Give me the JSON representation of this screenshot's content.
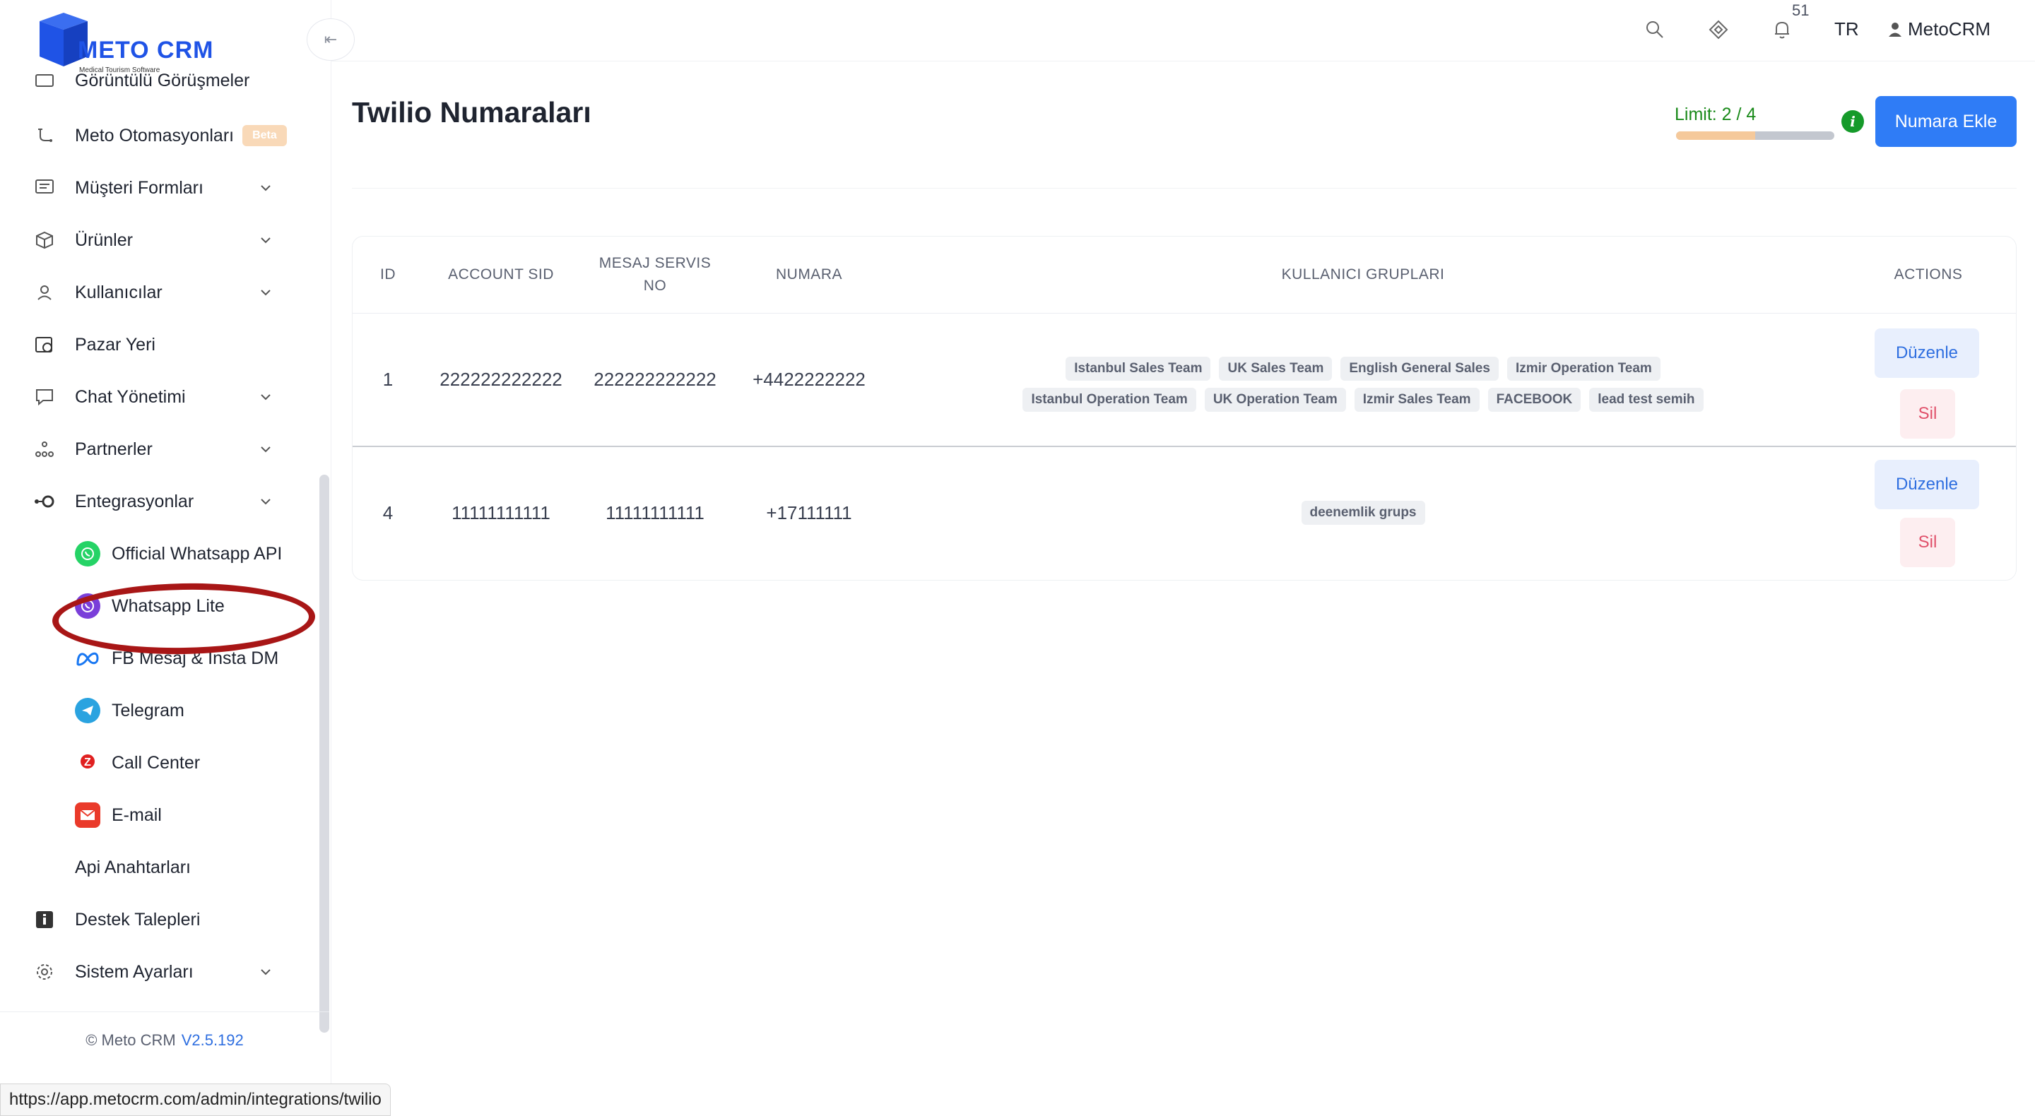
{
  "app": {
    "logo_text": "METO CRM",
    "logo_subtitle": "Medical Tourism Software",
    "brand_color": "#1f53e6"
  },
  "sidebar": {
    "items": [
      {
        "label": "Görüntülü Görüşmeler",
        "icon": "video-call-icon"
      },
      {
        "label": "Meto Otomasyonları",
        "icon": "automation-icon",
        "badge": "Beta"
      },
      {
        "label": "Müşteri Formları",
        "icon": "form-icon",
        "expandable": true
      },
      {
        "label": "Ürünler",
        "icon": "cube-icon",
        "expandable": true
      },
      {
        "label": "Kullanıcılar",
        "icon": "user-icon",
        "expandable": true
      },
      {
        "label": "Pazar Yeri",
        "icon": "marketplace-icon"
      },
      {
        "label": "Chat Yönetimi",
        "icon": "chat-icon",
        "expandable": true
      },
      {
        "label": "Partnerler",
        "icon": "partners-icon",
        "expandable": true
      },
      {
        "label": "Entegrasyonlar",
        "icon": "integration-icon",
        "expandable": true,
        "expanded": true
      }
    ],
    "integrations": [
      {
        "label": "Official Whatsapp API",
        "icon": "whatsapp-icon",
        "highlighted": true
      },
      {
        "label": "Whatsapp Lite",
        "icon": "whatsapp-lite-icon"
      },
      {
        "label": "FB Mesaj & Insta DM",
        "icon": "meta-icon"
      },
      {
        "label": "Telegram",
        "icon": "telegram-icon"
      },
      {
        "label": "Call Center",
        "icon": "call-center-icon"
      },
      {
        "label": "E-mail",
        "icon": "email-icon"
      }
    ],
    "after_items": [
      {
        "label": "Api Anahtarları"
      },
      {
        "label": "Destek Talepleri",
        "icon": "info-square-icon"
      },
      {
        "label": "Sistem Ayarları",
        "icon": "settings-icon",
        "expandable": true
      }
    ],
    "footer": {
      "copyright": "© Meto CRM",
      "version": "V2.5.192"
    }
  },
  "header": {
    "notification_count": "51",
    "language": "TR",
    "user_name": "MetoCRM"
  },
  "page": {
    "title": "Twilio Numaraları",
    "limit_text": "Limit: 2 / 4",
    "limit_used": 2,
    "limit_total": 4,
    "add_button": "Numara Ekle"
  },
  "table": {
    "headers": {
      "id": "ID",
      "account_sid": "ACCOUNT SID",
      "mesaj_servis_no": "MESAJ SERVIS NO",
      "numara": "NUMARA",
      "kullanici_gruplari": "KULLANICI GRUPLARI",
      "actions": "ACTIONS"
    },
    "rows": [
      {
        "id": "1",
        "account_sid": "222222222222",
        "mesaj_servis_no": "222222222222",
        "numara": "+4422222222",
        "groups": [
          "Istanbul Sales Team",
          "UK Sales Team",
          "English General Sales",
          "Izmir Operation Team",
          "Istanbul Operation Team",
          "UK Operation Team",
          "Izmir Sales Team",
          "FACEBOOK",
          "lead test semih"
        ],
        "edit_label": "Düzenle",
        "delete_label": "Sil"
      },
      {
        "id": "4",
        "account_sid": "11111111111",
        "mesaj_servis_no": "11111111111",
        "numara": "+17111111",
        "groups": [
          "deenemlik grups"
        ],
        "edit_label": "Düzenle",
        "delete_label": "Sil"
      }
    ]
  },
  "status_bar": {
    "url": "https://app.metocrm.com/admin/integrations/twilio"
  }
}
